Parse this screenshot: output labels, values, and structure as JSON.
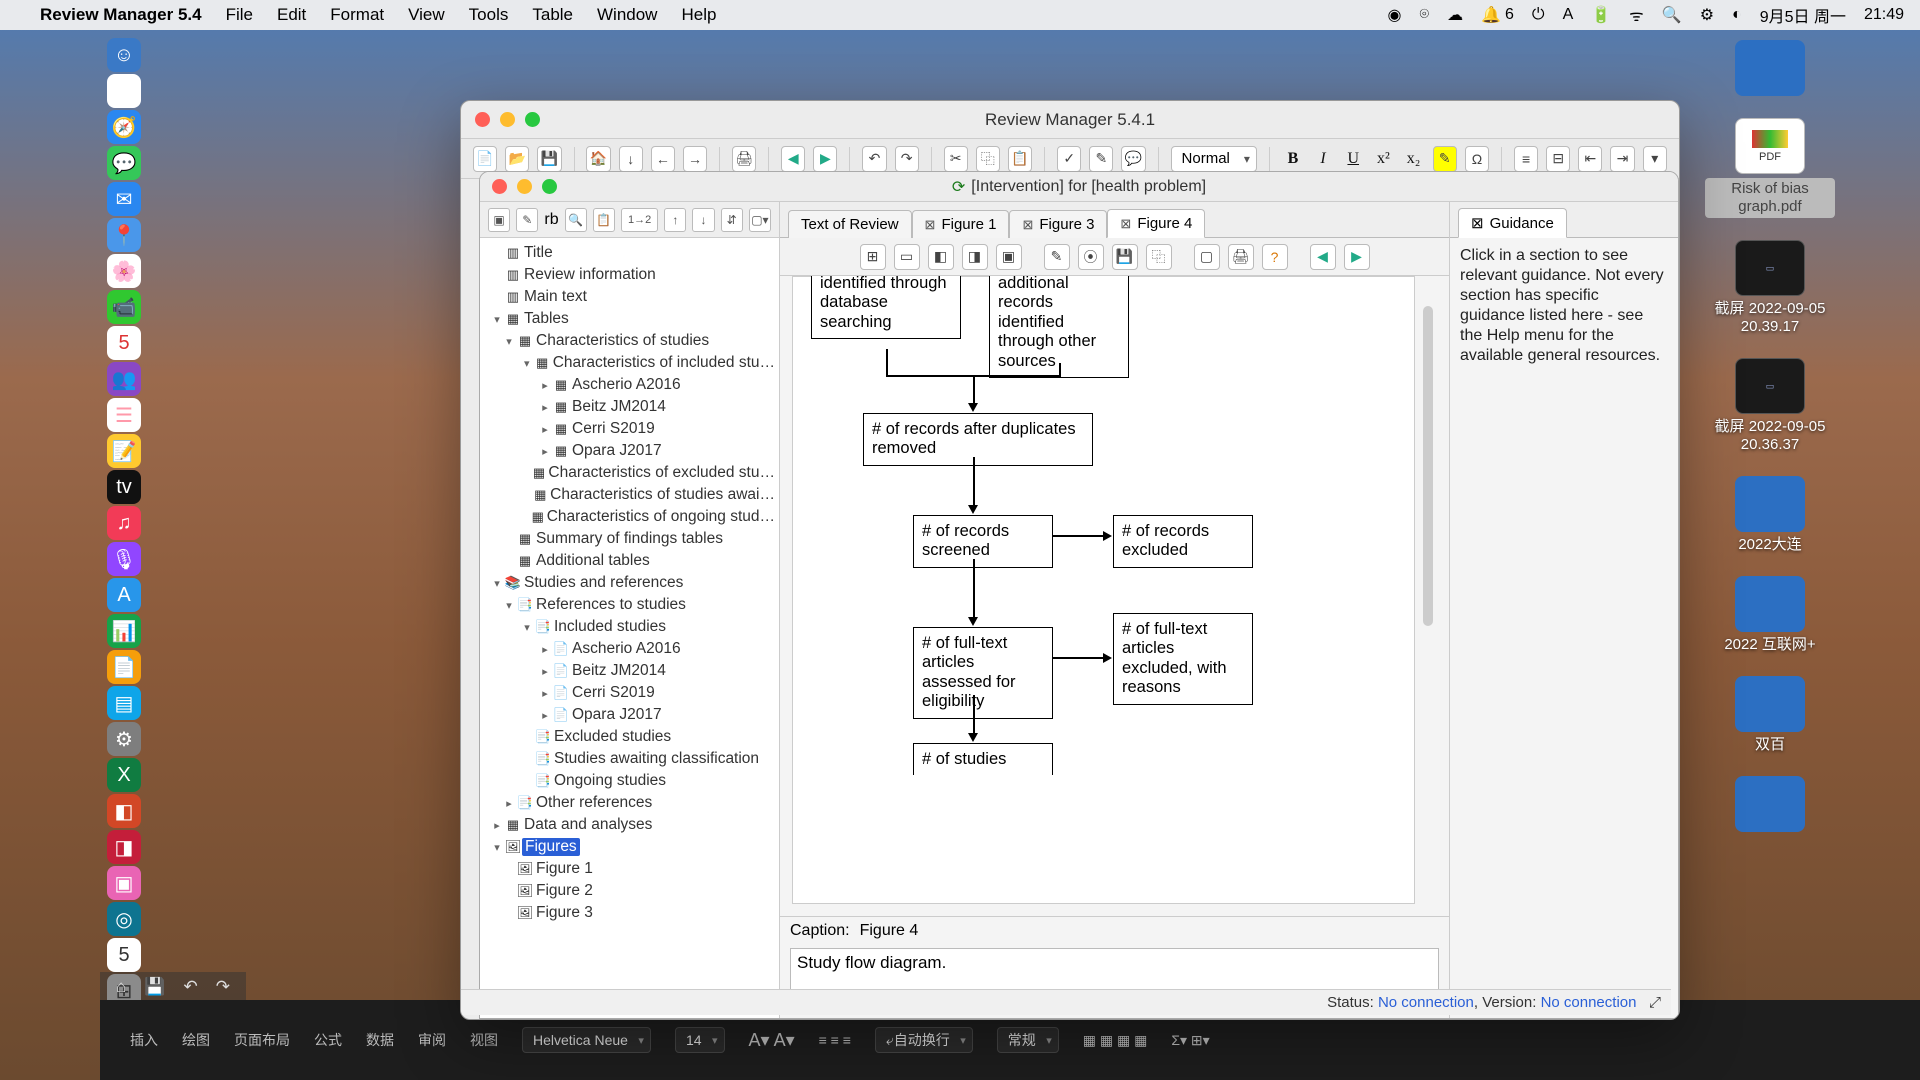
{
  "menubar": {
    "app_name": "Review Manager 5.4",
    "items": [
      "File",
      "Edit",
      "Format",
      "View",
      "Tools",
      "Table",
      "Window",
      "Help"
    ],
    "right": {
      "notif_count": "6",
      "date": "9月5日 周一",
      "time": "21:49"
    }
  },
  "desktop": {
    "pdf_label": "Risk of bias graph.pdf",
    "pdf_badge": "PDF",
    "shot1": "截屏 2022-09-05 20.39.17",
    "shot2": "截屏 2022-09-05 20.36.37",
    "folder1": "2022大连",
    "folder2": "2022 互联网+",
    "folder3": "双百"
  },
  "window": {
    "title": "Review Manager 5.4.1",
    "style_select": "Normal",
    "doc_title": "[Intervention] for [health problem]"
  },
  "toolbar2_12": "1→2",
  "tree": {
    "n_title": "Title",
    "n_revinfo": "Review information",
    "n_maintext": "Main text",
    "n_tables": "Tables",
    "n_cos": "Characteristics of studies",
    "n_cis": "Characteristics of included stu…",
    "s_a": "Ascherio A2016",
    "s_b": "Beitz JM2014",
    "s_c": "Cerri S2019",
    "s_d": "Opara J2017",
    "n_ces": "Characteristics of excluded stu…",
    "n_csa": "Characteristics of studies awai…",
    "n_cons": "Characteristics of ongoing stud…",
    "n_soft": "Summary of findings tables",
    "n_addt": "Additional tables",
    "n_sr": "Studies and references",
    "n_rts": "References to studies",
    "n_inc": "Included studies",
    "n_exc": "Excluded studies",
    "n_sac": "Studies awaiting classification",
    "n_ong": "Ongoing studies",
    "n_oth": "Other references",
    "n_daa": "Data and analyses",
    "n_figs": "Figures",
    "n_fig1": "Figure 1",
    "n_fig2": "Figure 2",
    "n_fig3": "Figure 3"
  },
  "tabs": {
    "t1": "Text of Review",
    "t2": "Figure 1",
    "t3": "Figure 3",
    "t4": "Figure 4"
  },
  "flow": {
    "box_db": "identified through database searching",
    "box_other": "additional records identified through other sources",
    "box_dup": "# of records after duplicates removed",
    "box_scr": "# of records screened",
    "box_excl": "# of records excluded",
    "box_full": "# of full-text articles assessed for eligibility",
    "box_fullexcl": "# of full-text articles excluded, with reasons",
    "box_studies": "# of studies"
  },
  "caption": {
    "label": "Caption:",
    "value": "Figure 4"
  },
  "desc": "Study flow diagram.",
  "guidance": {
    "tab": "Guidance",
    "text": "Click in a section to see relevant guidance. Not every section has specific guidance listed here - see the Help menu for the available general resources."
  },
  "status": {
    "prefix": "Status: ",
    "status_val": "No connection",
    "mid": ", Version: ",
    "version_val": "No connection"
  },
  "bottom": {
    "items": [
      "插入",
      "绘图",
      "页面布局",
      "公式",
      "数据",
      "审阅",
      "视图"
    ],
    "font": "Helvetica Neue",
    "size": "14",
    "wrap": "自动换行",
    "style": "常规"
  }
}
